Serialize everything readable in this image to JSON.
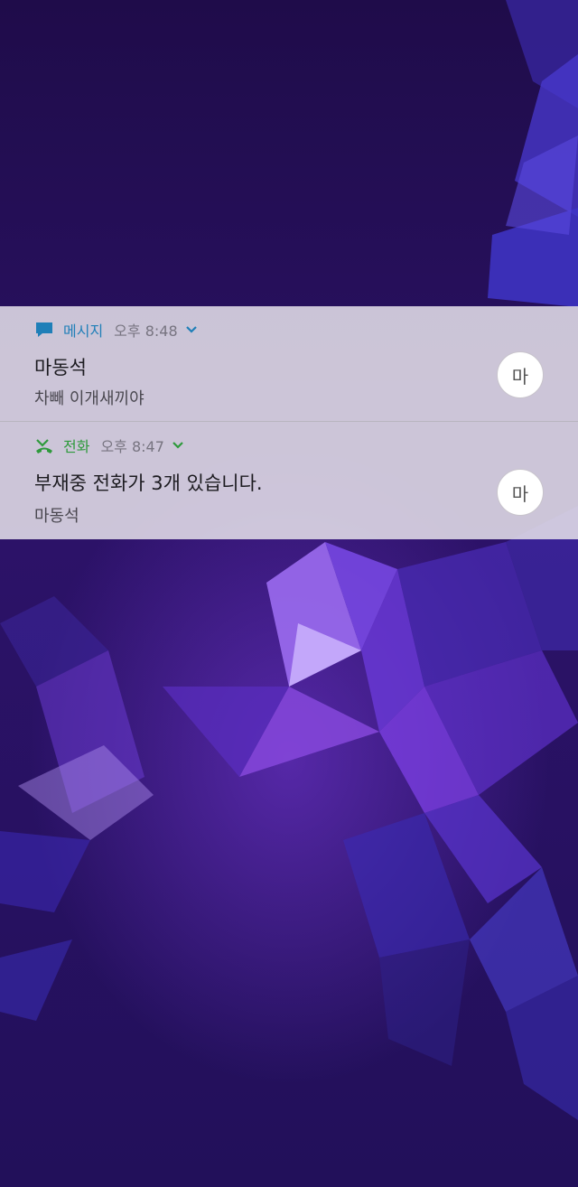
{
  "colors": {
    "message_accent": "#1f7fb8",
    "call_accent": "#2e9a3c",
    "panel_bg": "#e2dee8",
    "wallpaper_base": "#2a0f5e"
  },
  "notifications": [
    {
      "app": "메시지",
      "icon": "message-bubble-icon",
      "time": "오후 8:48",
      "title": "마동석",
      "body": "차빼 이개새끼야",
      "avatar": "마"
    },
    {
      "app": "전화",
      "icon": "missed-call-icon",
      "time": "오후 8:47",
      "title": "부재중 전화가 3개 있습니다.",
      "body": "마동석",
      "avatar": "마"
    }
  ]
}
